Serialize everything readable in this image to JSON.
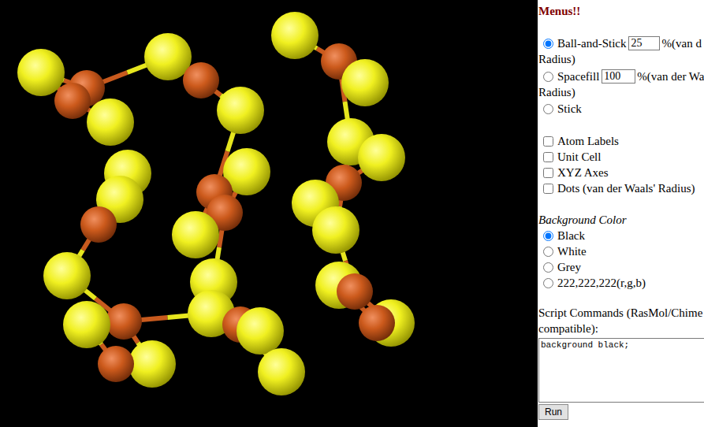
{
  "header": "Menus!!",
  "render_modes": [
    {
      "label": "Ball-and-Stick",
      "selected": true,
      "value": "25",
      "unit": "%(van d",
      "unit_cont": "Radius)"
    },
    {
      "label": "Spacefill",
      "selected": false,
      "value": "100",
      "unit": "%(van der Wa",
      "unit_cont": "Radius)"
    },
    {
      "label": "Stick",
      "selected": false
    }
  ],
  "options": [
    {
      "label": "Atom Labels",
      "checked": false
    },
    {
      "label": "Unit Cell",
      "checked": false
    },
    {
      "label": "XYZ Axes",
      "checked": false
    },
    {
      "label": "Dots (van der Waals' Radius)",
      "checked": false
    }
  ],
  "background": {
    "title": "Background Color",
    "choices": [
      {
        "label": "Black",
        "selected": true
      },
      {
        "label": "White",
        "selected": false
      },
      {
        "label": "Grey",
        "selected": false
      },
      {
        "label": "222,222,222(r,g,b)",
        "selected": false
      }
    ]
  },
  "script": {
    "label": "Script Commands (RasMol/Chime",
    "label_cont": "compatible):",
    "value": "background black;"
  },
  "buttons": [
    "Run"
  ]
}
